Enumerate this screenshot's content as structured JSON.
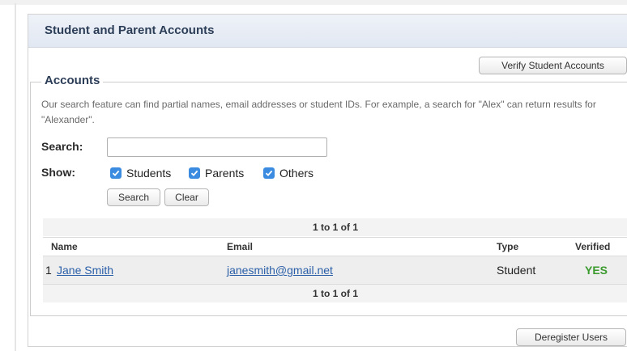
{
  "panel": {
    "title": "Student and Parent Accounts"
  },
  "toolbar": {
    "verify_label": "Verify Student Accounts",
    "deregister_label": "Deregister Users"
  },
  "accounts": {
    "legend": "Accounts",
    "help_text": "Our search feature can find partial names, email addresses or student IDs. For example, a search for \"Alex\" can return results for \"Alexander\".",
    "search_label": "Search:",
    "search_value": "",
    "show_label": "Show:",
    "filters": [
      {
        "label": "Students",
        "checked": true
      },
      {
        "label": "Parents",
        "checked": true
      },
      {
        "label": "Others",
        "checked": true
      }
    ],
    "search_button": "Search",
    "clear_button": "Clear"
  },
  "table": {
    "pager_top": "1 to 1 of 1",
    "pager_bottom": "1 to 1 of 1",
    "columns": [
      "Name",
      "Email",
      "Type",
      "Verified"
    ],
    "rows": [
      {
        "index": "1",
        "name": "Jane Smith",
        "email": "janesmith@gmail.net",
        "type": "Student",
        "verified": "YES"
      }
    ]
  },
  "colors": {
    "accent": "#3b8ce0",
    "link": "#2a5fa8",
    "verified_yes": "#3a9a2d",
    "title": "#2c3d57"
  }
}
